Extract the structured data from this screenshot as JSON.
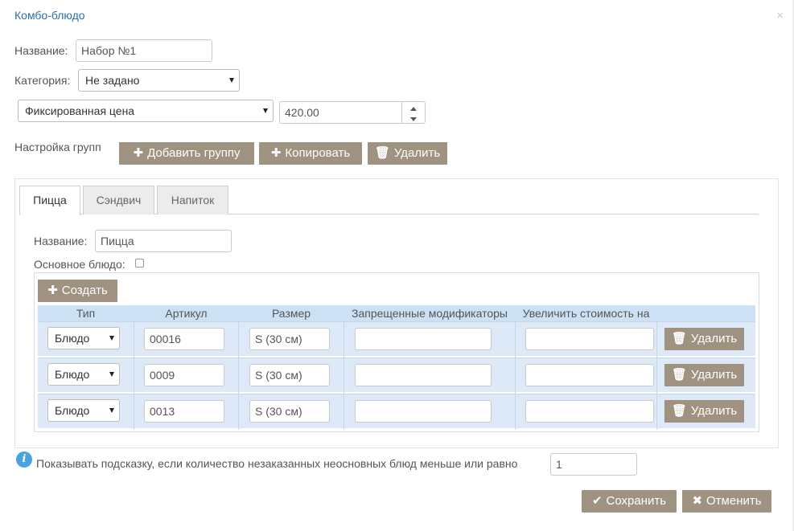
{
  "dialog": {
    "title": "Комбо-блюдо",
    "close_icon": "×"
  },
  "form": {
    "name_label": "Название:",
    "name_value": "Набор №1",
    "category_label": "Категория:",
    "category_value": "Не задано",
    "price_type_value": "Фиксированная цена",
    "price_value": "420.00"
  },
  "groups": {
    "label": "Настройка групп",
    "add_label": "Добавить группу",
    "copy_label": "Копировать",
    "delete_label": "Удалить",
    "tabs": [
      {
        "label": "Пицца"
      },
      {
        "label": "Сэндвич"
      },
      {
        "label": "Напиток"
      }
    ]
  },
  "group": {
    "name_label": "Название:",
    "name_value": "Пицца",
    "main_dish_label": "Основное блюдо:",
    "main_dish_checked": false,
    "create_label": "Создать"
  },
  "table": {
    "headers": [
      "Тип",
      "Артикул",
      "Размер",
      "Запрещенные модификаторы",
      "Увеличить стоимость на"
    ],
    "rows": [
      {
        "type": "Блюдо",
        "article": "00016",
        "size": "S (30 см)",
        "forbidden": "",
        "increase": "",
        "delete_label": "Удалить"
      },
      {
        "type": "Блюдо",
        "article": "0009",
        "size": "S (30 см)",
        "forbidden": "",
        "increase": "",
        "delete_label": "Удалить"
      },
      {
        "type": "Блюдо",
        "article": "0013",
        "size": "S (30 см)",
        "forbidden": "",
        "increase": "",
        "delete_label": "Удалить"
      }
    ]
  },
  "hint": {
    "icon": "i",
    "text": "Показывать подсказку, если количество незаказанных неосновных блюд меньше или равно",
    "value": "1"
  },
  "footer": {
    "save_label": "Сохранить",
    "cancel_label": "Отменить"
  },
  "icons": {
    "plus": "✚",
    "trash": "🗑",
    "check": "✔",
    "cross": "✖"
  },
  "colors": {
    "button_bg": "#a09280",
    "title": "#2a6fa8",
    "row_bg": "#dde9f7",
    "header_bg": "#cde1f5",
    "info": "#4aa3df"
  }
}
